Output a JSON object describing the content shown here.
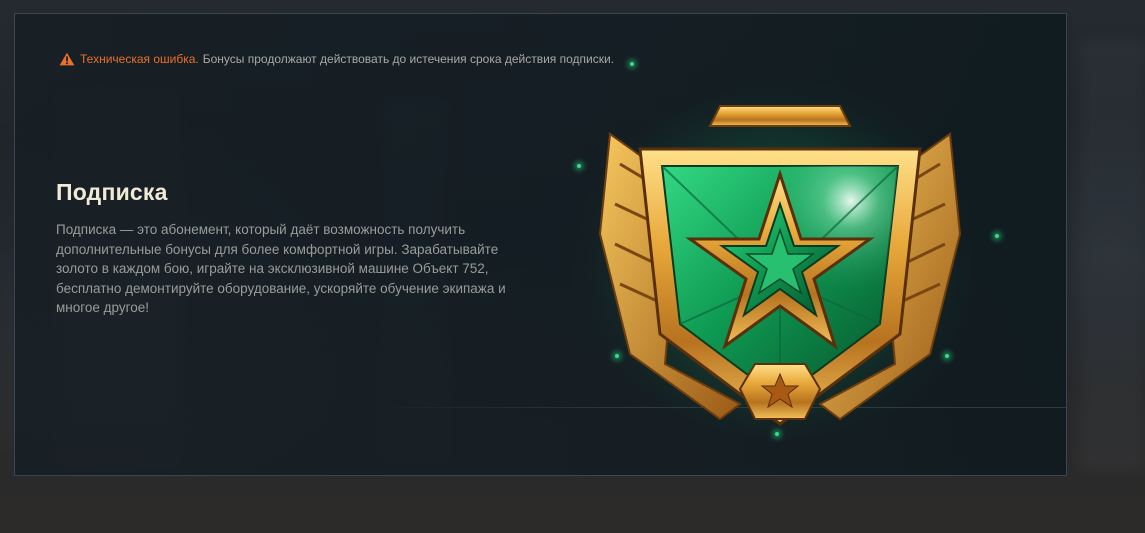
{
  "notice": {
    "icon": "warning-triangle-icon",
    "error_label": "Техническая ошибка.",
    "message": "Бонусы продолжают действовать до истечения срока действия подписки.",
    "error_color": "#e8702a"
  },
  "subscription": {
    "title": "Подписка",
    "description": "Подписка — это абонемент, который даёт возможность получить дополнительные бонусы для более комфортной игры. Зарабатывайте золото в каждом бою, играйте на эксклюзивной машине Объект 752, бесплатно демонтируйте оборудование, ускоряйте обучение экипажа и многое другое!",
    "emblem": "gold-green-star-shield-emblem",
    "accent_gold": "#e6a93a",
    "accent_green": "#1fa85f"
  }
}
